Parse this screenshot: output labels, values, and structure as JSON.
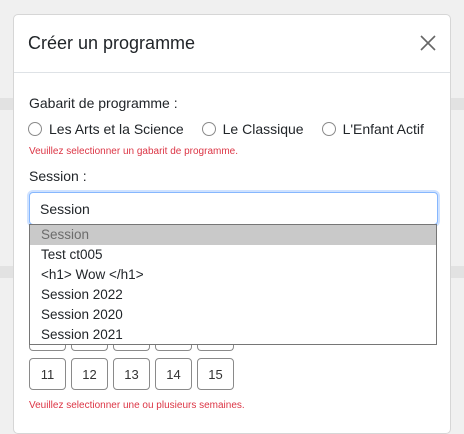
{
  "modal": {
    "title": "Créer un programme",
    "close_icon": "close-icon"
  },
  "template": {
    "label": "Gabarit de programme :",
    "options": [
      "Les Arts et la Science",
      "Le Classique",
      "L'Enfant Actif"
    ],
    "error": "Veuillez selectionner un gabarit de programme."
  },
  "session": {
    "label": "Session :",
    "value": "Session",
    "options": [
      "Session",
      "Test ct005",
      "<h1> Wow </h1>",
      "Session 2022",
      "Session 2020",
      "Session 2021"
    ]
  },
  "weeks": {
    "row2": [
      "11",
      "12",
      "13",
      "14",
      "15"
    ],
    "error": "Veuillez selectionner une ou plusieurs semaines."
  }
}
